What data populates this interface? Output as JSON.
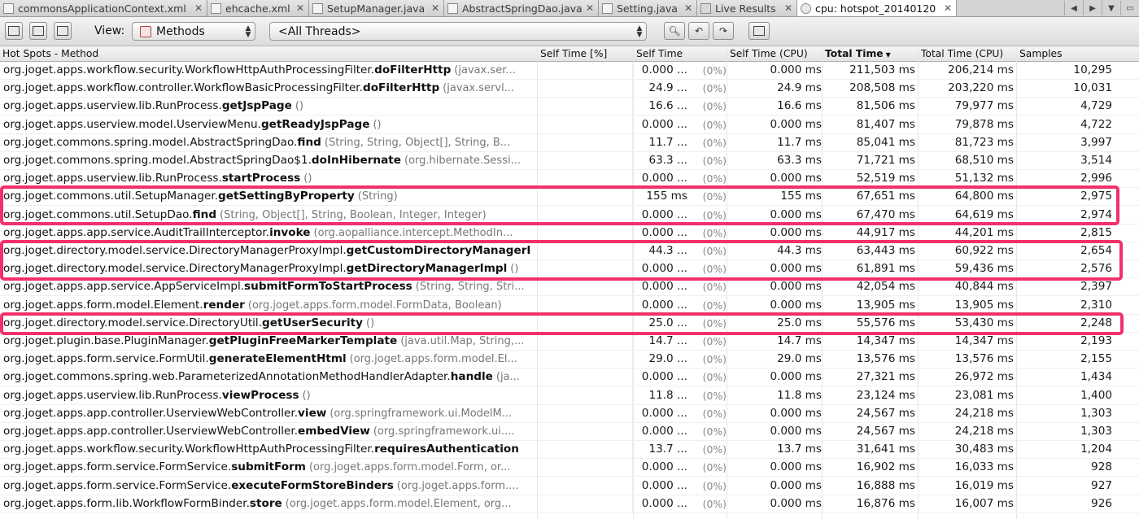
{
  "tabs": [
    {
      "label": "commonsApplicationContext.xml",
      "active": false,
      "icon": "xml-file-icon"
    },
    {
      "label": "ehcache.xml",
      "active": false,
      "icon": "xml-file-icon"
    },
    {
      "label": "SetupManager.java",
      "active": false,
      "icon": "java-file-icon"
    },
    {
      "label": "AbstractSpringDao.java",
      "active": false,
      "icon": "java-file-icon"
    },
    {
      "label": "Setting.java",
      "active": false,
      "icon": "java-file-icon"
    },
    {
      "label": "Live Results",
      "active": false,
      "icon": "live-results-icon"
    },
    {
      "label": "cpu: hotspot_20140120",
      "active": true,
      "icon": "cpu-snapshot-icon"
    }
  ],
  "toolbar": {
    "view_label": "View:",
    "view_value": "Methods",
    "thread_value": "<All Threads>"
  },
  "columns": {
    "method": "Hot Spots - Method",
    "self_pct": "Self Time [%]",
    "self_time": "Self Time",
    "self_cpu": "Self Time (CPU)",
    "total": "Total Time",
    "total_cpu": "Total Time (CPU)",
    "samples": "Samples"
  },
  "rows": [
    {
      "pkg": "org.joget.apps.workflow.security.WorkflowHttpAuthProcessingFilter.",
      "method": "doFilterHttp",
      "sig": "(javax.ser...",
      "self": "0.000 ...",
      "pct": "(0%)",
      "self_cpu": "0.000 ms",
      "total": "211,503 ms",
      "total_cpu": "206,214 ms",
      "samples": "10,295"
    },
    {
      "pkg": "org.joget.apps.workflow.controller.WorkflowBasicProcessingFilter.",
      "method": "doFilterHttp",
      "sig": "(javax.servl...",
      "self": "24.9 ...",
      "pct": "(0%)",
      "self_cpu": "24.9 ms",
      "total": "208,508 ms",
      "total_cpu": "203,220 ms",
      "samples": "10,031"
    },
    {
      "pkg": "org.joget.apps.userview.lib.RunProcess.",
      "method": "getJspPage",
      "sig": "()",
      "self": "16.6 ...",
      "pct": "(0%)",
      "self_cpu": "16.6 ms",
      "total": "81,506 ms",
      "total_cpu": "79,977 ms",
      "samples": "4,729"
    },
    {
      "pkg": "org.joget.apps.userview.model.UserviewMenu.",
      "method": "getReadyJspPage",
      "sig": "()",
      "self": "0.000 ...",
      "pct": "(0%)",
      "self_cpu": "0.000 ms",
      "total": "81,407 ms",
      "total_cpu": "79,878 ms",
      "samples": "4,722"
    },
    {
      "pkg": "org.joget.commons.spring.model.AbstractSpringDao.",
      "method": "find",
      "sig": "(String, String, Object[], String, B...",
      "self": "11.7 ...",
      "pct": "(0%)",
      "self_cpu": "11.7 ms",
      "total": "85,041 ms",
      "total_cpu": "81,723 ms",
      "samples": "3,997"
    },
    {
      "pkg": "org.joget.commons.spring.model.AbstractSpringDao$1.",
      "method": "doInHibernate",
      "sig": "(org.hibernate.Sessi...",
      "self": "63.3 ...",
      "pct": "(0%)",
      "self_cpu": "63.3 ms",
      "total": "71,721 ms",
      "total_cpu": "68,510 ms",
      "samples": "3,514"
    },
    {
      "pkg": "org.joget.apps.userview.lib.RunProcess.",
      "method": "startProcess",
      "sig": "()",
      "self": "0.000 ...",
      "pct": "(0%)",
      "self_cpu": "0.000 ms",
      "total": "52,519 ms",
      "total_cpu": "51,132 ms",
      "samples": "2,996"
    },
    {
      "pkg": "org.joget.commons.util.SetupManager.",
      "method": "getSettingByProperty",
      "sig": "(String)",
      "self": "155 ms",
      "pct": "(0%)",
      "self_cpu": "155 ms",
      "total": "67,651 ms",
      "total_cpu": "64,800 ms",
      "samples": "2,975"
    },
    {
      "pkg": "org.joget.commons.util.SetupDao.",
      "method": "find",
      "sig": "(String, Object[], String, Boolean, Integer, Integer)",
      "self": "0.000 ...",
      "pct": "(0%)",
      "self_cpu": "0.000 ms",
      "total": "67,470 ms",
      "total_cpu": "64,619 ms",
      "samples": "2,974"
    },
    {
      "pkg": "org.joget.apps.app.service.AuditTrailInterceptor.",
      "method": "invoke",
      "sig": "(org.aopalliance.intercept.MethodIn...",
      "self": "0.000 ...",
      "pct": "(0%)",
      "self_cpu": "0.000 ms",
      "total": "44,917 ms",
      "total_cpu": "44,201 ms",
      "samples": "2,815"
    },
    {
      "pkg": "org.joget.directory.model.service.DirectoryManagerProxyImpl.",
      "method": "getCustomDirectoryManagerI",
      "sig": "",
      "self": "44.3 ...",
      "pct": "(0%)",
      "self_cpu": "44.3 ms",
      "total": "63,443 ms",
      "total_cpu": "60,922 ms",
      "samples": "2,654"
    },
    {
      "pkg": "org.joget.directory.model.service.DirectoryManagerProxyImpl.",
      "method": "getDirectoryManagerImpl",
      "sig": "()",
      "self": "0.000 ...",
      "pct": "(0%)",
      "self_cpu": "0.000 ms",
      "total": "61,891 ms",
      "total_cpu": "59,436 ms",
      "samples": "2,576"
    },
    {
      "pkg": "org.joget.apps.app.service.AppServiceImpl.",
      "method": "submitFormToStartProcess",
      "sig": "(String, String, Stri...",
      "self": "0.000 ...",
      "pct": "(0%)",
      "self_cpu": "0.000 ms",
      "total": "42,054 ms",
      "total_cpu": "40,844 ms",
      "samples": "2,397"
    },
    {
      "pkg": "org.joget.apps.form.model.Element.",
      "method": "render",
      "sig": "(org.joget.apps.form.model.FormData, Boolean)",
      "self": "0.000 ...",
      "pct": "(0%)",
      "self_cpu": "0.000 ms",
      "total": "13,905 ms",
      "total_cpu": "13,905 ms",
      "samples": "2,310"
    },
    {
      "pkg": "org.joget.directory.model.service.DirectoryUtil.",
      "method": "getUserSecurity",
      "sig": "()",
      "self": "25.0 ...",
      "pct": "(0%)",
      "self_cpu": "25.0 ms",
      "total": "55,576 ms",
      "total_cpu": "53,430 ms",
      "samples": "2,248"
    },
    {
      "pkg": "org.joget.plugin.base.PluginManager.",
      "method": "getPluginFreeMarkerTemplate",
      "sig": "(java.util.Map, String,...",
      "self": "14.7 ...",
      "pct": "(0%)",
      "self_cpu": "14.7 ms",
      "total": "14,347 ms",
      "total_cpu": "14,347 ms",
      "samples": "2,193"
    },
    {
      "pkg": "org.joget.apps.form.service.FormUtil.",
      "method": "generateElementHtml",
      "sig": "(org.joget.apps.form.model.El...",
      "self": "29.0 ...",
      "pct": "(0%)",
      "self_cpu": "29.0 ms",
      "total": "13,576 ms",
      "total_cpu": "13,576 ms",
      "samples": "2,155"
    },
    {
      "pkg": "org.joget.commons.spring.web.ParameterizedAnnotationMethodHandlerAdapter.",
      "method": "handle",
      "sig": "(ja...",
      "self": "0.000 ...",
      "pct": "(0%)",
      "self_cpu": "0.000 ms",
      "total": "27,321 ms",
      "total_cpu": "26,972 ms",
      "samples": "1,434"
    },
    {
      "pkg": "org.joget.apps.userview.lib.RunProcess.",
      "method": "viewProcess",
      "sig": "()",
      "self": "11.8 ...",
      "pct": "(0%)",
      "self_cpu": "11.8 ms",
      "total": "23,124 ms",
      "total_cpu": "23,081 ms",
      "samples": "1,400"
    },
    {
      "pkg": "org.joget.apps.app.controller.UserviewWebController.",
      "method": "view",
      "sig": "(org.springframework.ui.ModelM...",
      "self": "0.000 ...",
      "pct": "(0%)",
      "self_cpu": "0.000 ms",
      "total": "24,567 ms",
      "total_cpu": "24,218 ms",
      "samples": "1,303"
    },
    {
      "pkg": "org.joget.apps.app.controller.UserviewWebController.",
      "method": "embedView",
      "sig": "(org.springframework.ui....",
      "self": "0.000 ...",
      "pct": "(0%)",
      "self_cpu": "0.000 ms",
      "total": "24,567 ms",
      "total_cpu": "24,218 ms",
      "samples": "1,303"
    },
    {
      "pkg": "org.joget.apps.workflow.security.WorkflowHttpAuthProcessingFilter.",
      "method": "requiresAuthentication",
      "sig": "",
      "self": "13.7 ...",
      "pct": "(0%)",
      "self_cpu": "13.7 ms",
      "total": "31,641 ms",
      "total_cpu": "30,483 ms",
      "samples": "1,204"
    },
    {
      "pkg": "org.joget.apps.form.service.FormService.",
      "method": "submitForm",
      "sig": "(org.joget.apps.form.model.Form, or...",
      "self": "0.000 ...",
      "pct": "(0%)",
      "self_cpu": "0.000 ms",
      "total": "16,902 ms",
      "total_cpu": "16,033 ms",
      "samples": "928"
    },
    {
      "pkg": "org.joget.apps.form.service.FormService.",
      "method": "executeFormStoreBinders",
      "sig": "(org.joget.apps.form....",
      "self": "0.000 ...",
      "pct": "(0%)",
      "self_cpu": "0.000 ms",
      "total": "16,888 ms",
      "total_cpu": "16,019 ms",
      "samples": "927"
    },
    {
      "pkg": "org.joget.apps.form.lib.WorkflowFormBinder.",
      "method": "store",
      "sig": "(org.joget.apps.form.model.Element, org...",
      "self": "0.000 ...",
      "pct": "(0%)",
      "self_cpu": "0.000 ms",
      "total": "16,876 ms",
      "total_cpu": "16,007 ms",
      "samples": "926"
    }
  ],
  "highlight_color": "#f2306b"
}
